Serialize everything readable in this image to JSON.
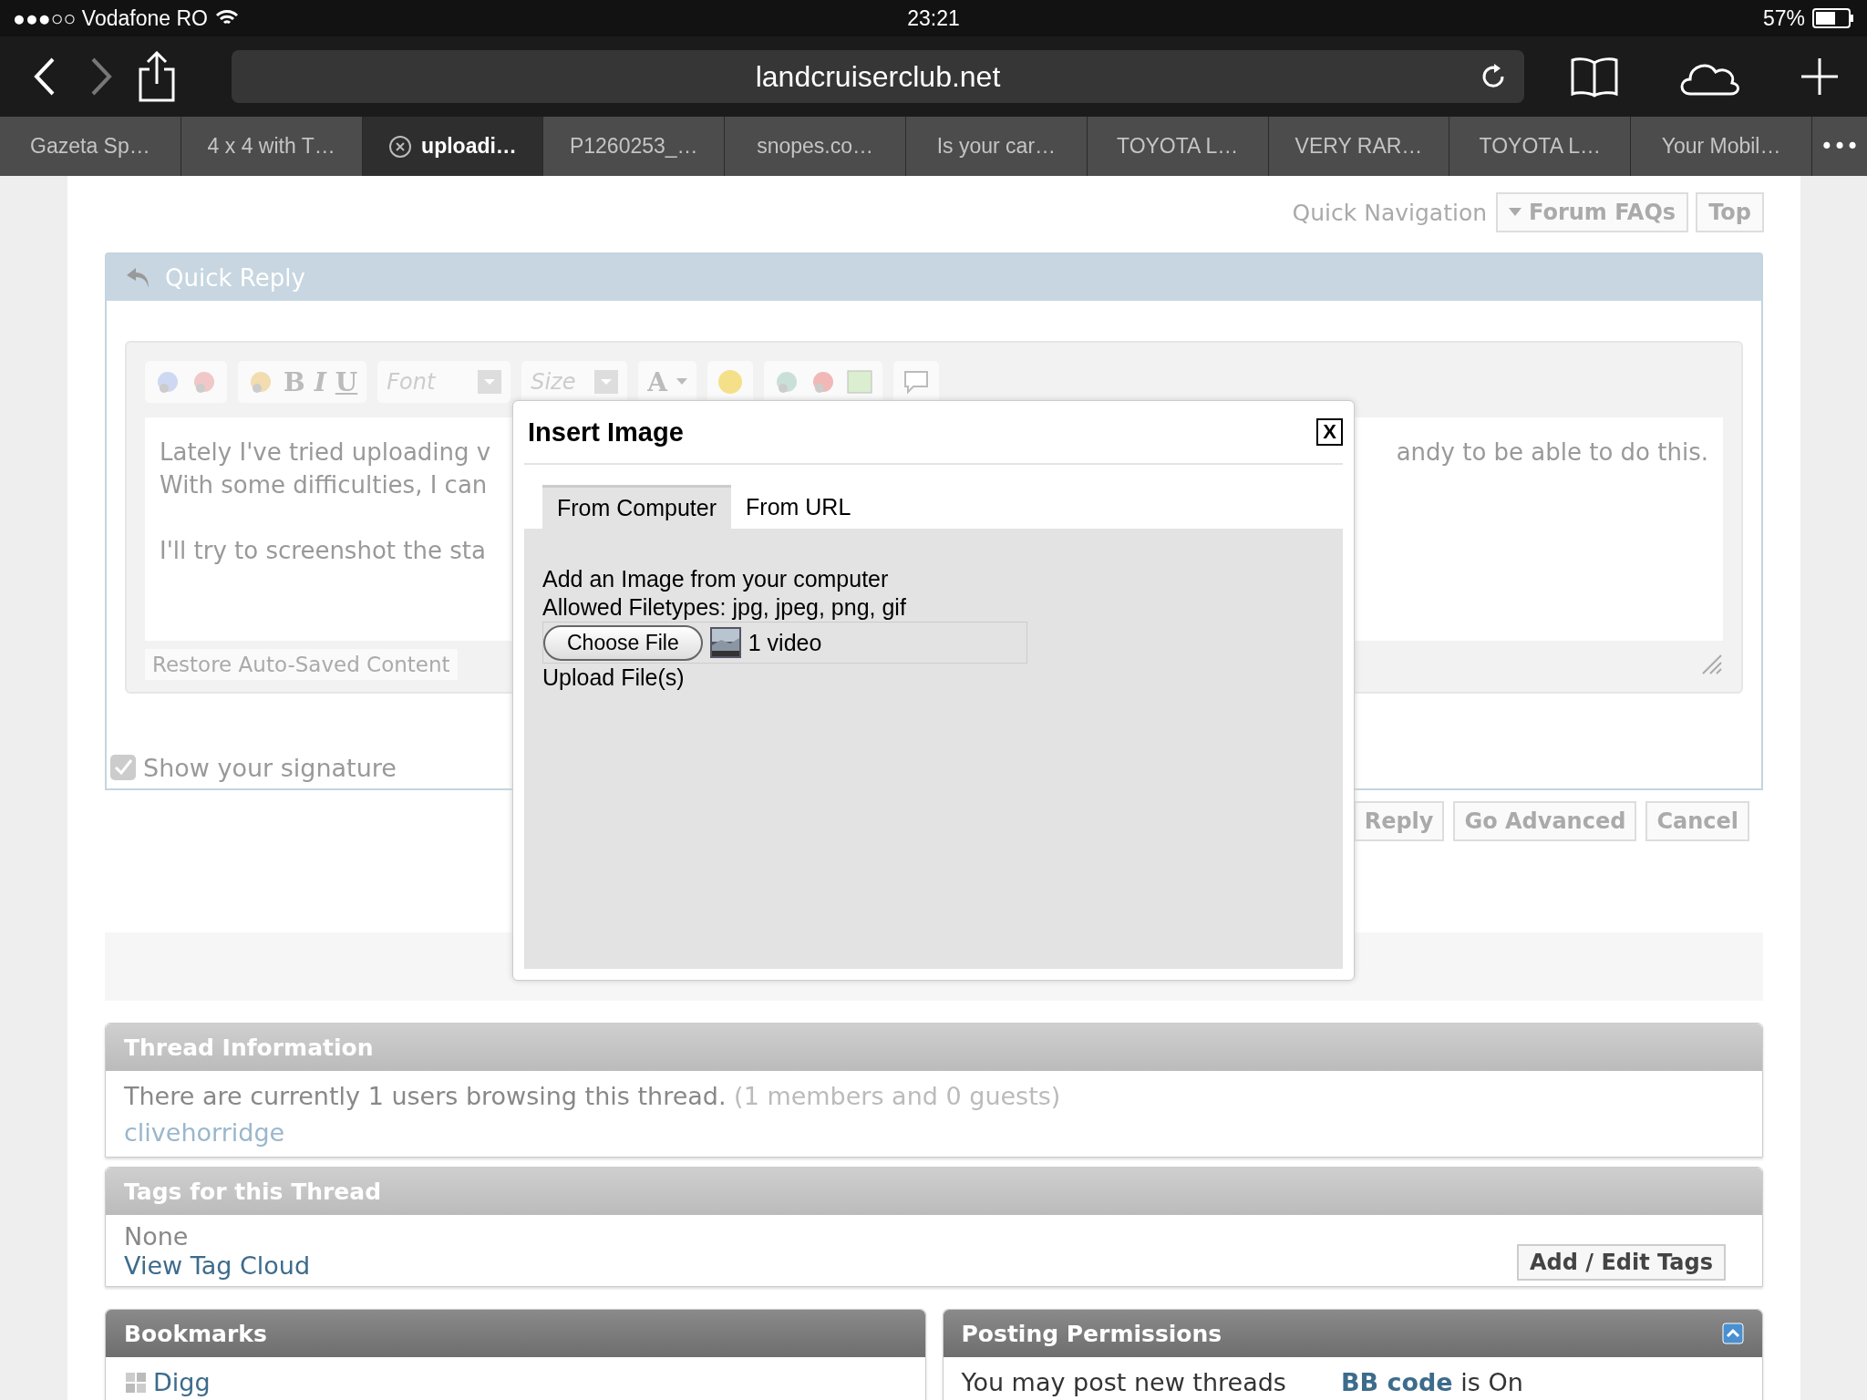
{
  "status_bar": {
    "carrier": "●●●○○ Vodafone RO",
    "time": "23:21",
    "battery": "57%"
  },
  "browser": {
    "url": "landcruiserclub.net"
  },
  "tabs": [
    {
      "label": "Gazeta Sp…",
      "selected": false
    },
    {
      "label": "4 x 4 with T…",
      "selected": false
    },
    {
      "label": "uploadi…",
      "selected": true
    },
    {
      "label": "P1260253_…",
      "selected": false
    },
    {
      "label": "snopes.co…",
      "selected": false
    },
    {
      "label": "Is your car…",
      "selected": false
    },
    {
      "label": "TOYOTA L…",
      "selected": false
    },
    {
      "label": "VERY RAR…",
      "selected": false
    },
    {
      "label": "TOYOTA L…",
      "selected": false
    },
    {
      "label": "Your Mobil…",
      "selected": false
    }
  ],
  "tabs_more": "•••",
  "quick_navigation": {
    "label": "Quick Navigation",
    "buttons": [
      {
        "label": "Forum FAQs",
        "kind": "dropdown"
      },
      {
        "label": "Top",
        "kind": "plain"
      }
    ]
  },
  "quick_reply": {
    "title": "Quick Reply",
    "toolbar": {
      "format_buttons": [
        "B",
        "I",
        "U"
      ],
      "font": "Font",
      "size": "Size",
      "color_button": "A"
    },
    "editor_left": [
      [
        "Lately I've tried uploading v",
        "With some difficulties, I can"
      ],
      [
        "I'll try to screenshot the sta"
      ]
    ],
    "editor_right": [
      "andy to be able to do this."
    ],
    "restore": "Restore Auto-Saved Content",
    "signature": {
      "label": "Show your signature",
      "checked": true
    }
  },
  "reply_buttons": [
    "Reply",
    "Go Advanced",
    "Cancel"
  ],
  "thread_info": {
    "title": "Thread Information",
    "text": "There are currently 1 users browsing this thread.",
    "counts": "(1 members and 0 guests)",
    "users": [
      "clivehorridge"
    ]
  },
  "tags": {
    "title": "Tags for this Thread",
    "value": "None",
    "link": "View Tag Cloud",
    "button": "Add / Edit Tags"
  },
  "bookmarks": {
    "title": "Bookmarks",
    "items": [
      "Digg"
    ]
  },
  "posting_permissions": {
    "title": "Posting Permissions",
    "text": "You may post new threads",
    "bbcode": "BB code",
    "bbcode_state": "is On"
  },
  "dialog": {
    "title": "Insert Image",
    "close": "X",
    "tabs": [
      {
        "label": "From Computer",
        "selected": true
      },
      {
        "label": "From URL",
        "selected": false
      }
    ],
    "heading": "Add an Image from your computer",
    "filetypes": "Allowed Filetypes: jpg, jpeg, png, gif",
    "choose": "Choose File",
    "file": "1 video",
    "upload": "Upload File(s)"
  }
}
